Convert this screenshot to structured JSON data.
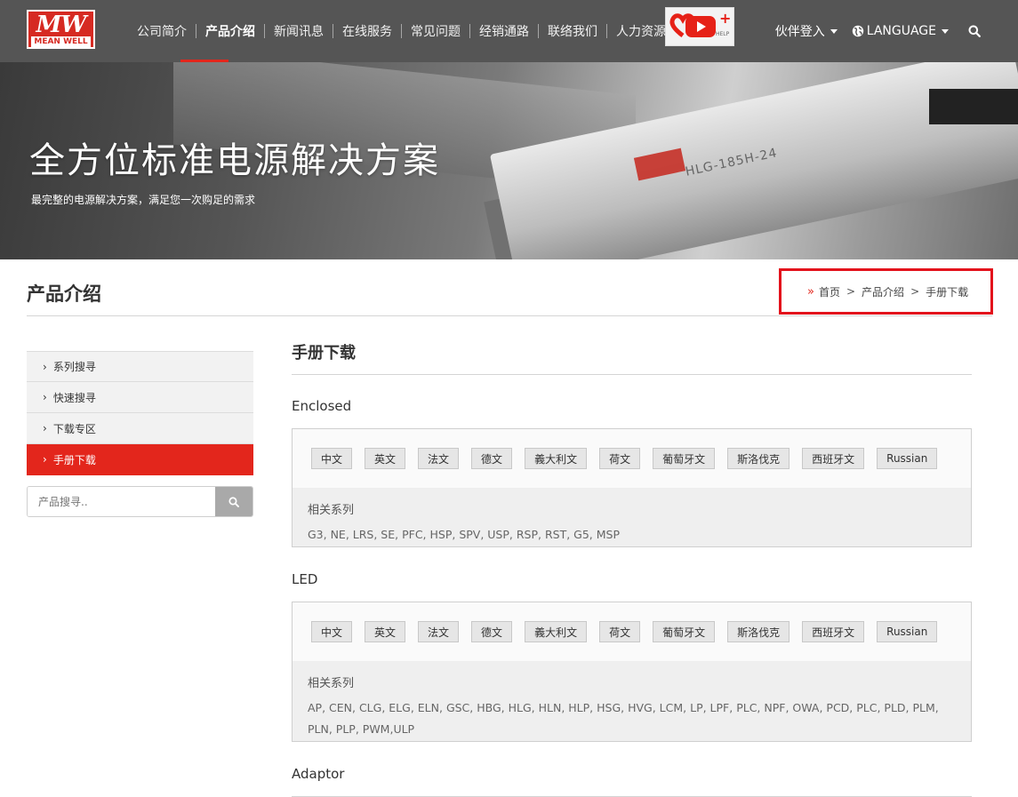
{
  "header": {
    "logo": {
      "mark": "MW",
      "name": "MEAN WELL"
    },
    "nav": [
      {
        "label": "公司简介"
      },
      {
        "label": "产品介绍",
        "active": true
      },
      {
        "label": "新闻讯息"
      },
      {
        "label": "在线服务"
      },
      {
        "label": "常见问题"
      },
      {
        "label": "经销通路"
      },
      {
        "label": "联络我们"
      },
      {
        "label": "人力资源"
      }
    ],
    "youtube_badge": {
      "plus": "+",
      "help": "HELP"
    },
    "partner_login": "伙伴登入",
    "language": "LANGUAGE"
  },
  "hero": {
    "title": "全方位标准电源解决方案",
    "subtitle": "最完整的电源解决方案，满足您一次购足的需求",
    "product_label": "HLG-185H-24"
  },
  "page": {
    "title": "产品介绍",
    "breadcrumb": [
      "首页",
      "产品介绍",
      "手册下载"
    ],
    "breadcrumb_sep": ">"
  },
  "sidebar": {
    "items": [
      {
        "label": "系列搜寻"
      },
      {
        "label": "快速搜寻"
      },
      {
        "label": "下载专区"
      },
      {
        "label": "手册下载",
        "active": true
      }
    ],
    "search_placeholder": "产品搜寻.."
  },
  "main": {
    "title": "手册下载",
    "related_label": "相关系列",
    "languages": [
      "中文",
      "英文",
      "法文",
      "德文",
      "義大利文",
      "荷文",
      "葡萄牙文",
      "斯洛伐克",
      "西班牙文",
      "Russian"
    ],
    "categories": [
      {
        "name": "Enclosed",
        "series": "G3, NE, LRS, SE, PFC, HSP, SPV, USP, RSP, RST, G5, MSP"
      },
      {
        "name": "LED",
        "series": "AP, CEN, CLG, ELG, ELN, GSC, HBG, HLG, HLN, HLP, HSG, HVG, LCM, LP, LPF, PLC, NPF, OWA, PCD, PLC, PLD, PLM, PLN, PLP, PWM,ULP"
      },
      {
        "name": "Adaptor"
      }
    ]
  },
  "colors": {
    "header_bg": "#555555",
    "accent_red": "#e3261c",
    "breadcrumb_highlight": "#e3121c"
  }
}
